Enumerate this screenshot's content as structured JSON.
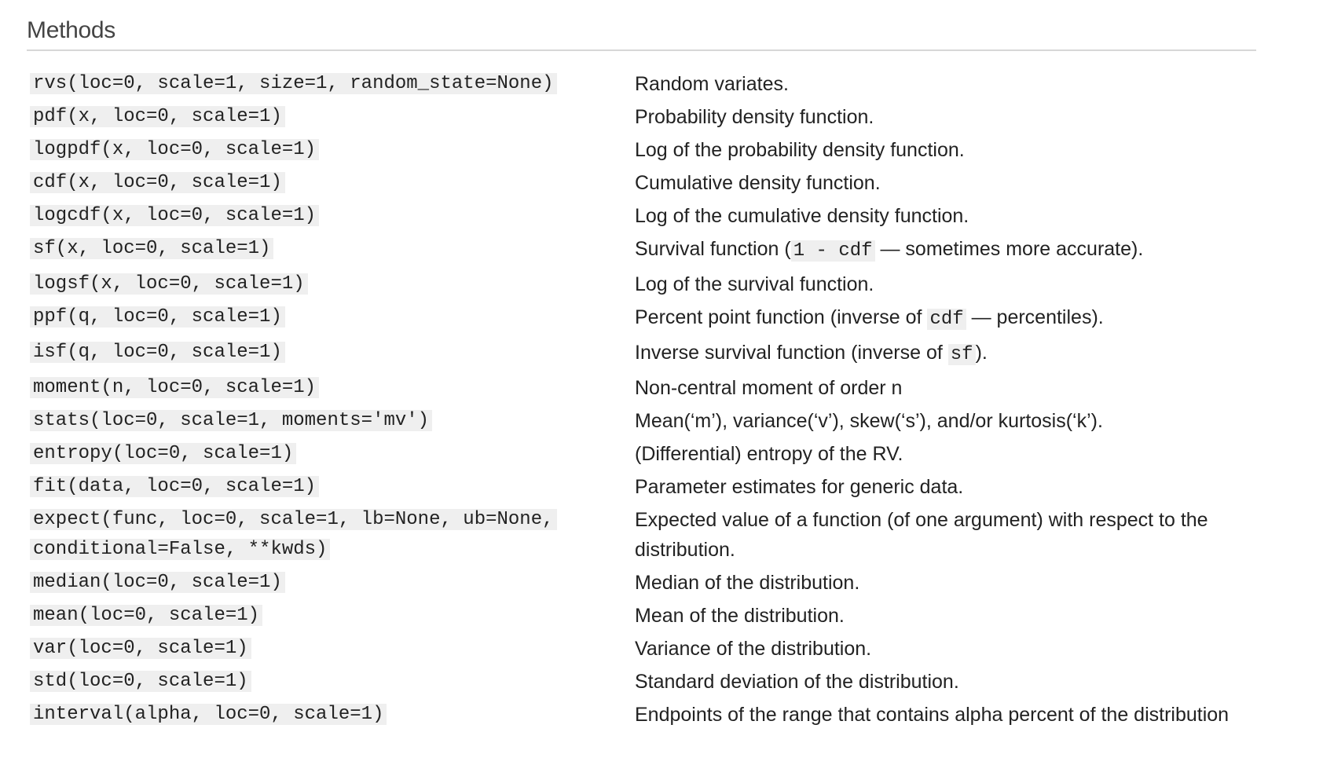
{
  "section": {
    "title": "Methods"
  },
  "methods": [
    {
      "signature": "rvs(loc=0, scale=1, size=1, random_state=None)",
      "desc": [
        "Random variates."
      ]
    },
    {
      "signature": "pdf(x, loc=0, scale=1)",
      "desc": [
        "Probability density function."
      ]
    },
    {
      "signature": "logpdf(x, loc=0, scale=1)",
      "desc": [
        "Log of the probability density function."
      ]
    },
    {
      "signature": "cdf(x, loc=0, scale=1)",
      "desc": [
        "Cumulative density function."
      ]
    },
    {
      "signature": "logcdf(x, loc=0, scale=1)",
      "desc": [
        "Log of the cumulative density function."
      ]
    },
    {
      "signature": "sf(x, loc=0, scale=1)",
      "desc": [
        "Survival function (",
        {
          "code": "1 - cdf"
        },
        " — sometimes more accurate)."
      ]
    },
    {
      "signature": "logsf(x, loc=0, scale=1)",
      "desc": [
        "Log of the survival function."
      ]
    },
    {
      "signature": "ppf(q, loc=0, scale=1)",
      "desc": [
        "Percent point function (inverse of ",
        {
          "code": "cdf"
        },
        " — percentiles)."
      ]
    },
    {
      "signature": "isf(q, loc=0, scale=1)",
      "desc": [
        "Inverse survival function (inverse of ",
        {
          "code": "sf"
        },
        ")."
      ]
    },
    {
      "signature": "moment(n, loc=0, scale=1)",
      "desc": [
        "Non-central moment of order n"
      ]
    },
    {
      "signature": "stats(loc=0, scale=1, moments='mv')",
      "desc": [
        "Mean(‘m’), variance(‘v’), skew(‘s’), and/or kurtosis(‘k’)."
      ]
    },
    {
      "signature": "entropy(loc=0, scale=1)",
      "desc": [
        "(Differential) entropy of the RV."
      ]
    },
    {
      "signature": "fit(data, loc=0, scale=1)",
      "desc": [
        "Parameter estimates for generic data."
      ]
    },
    {
      "signature": "expect(func, loc=0, scale=1, lb=None, ub=None, conditional=False, **kwds)",
      "desc": [
        "Expected value of a function (of one argument) with respect to the distribution."
      ]
    },
    {
      "signature": "median(loc=0, scale=1)",
      "desc": [
        "Median of the distribution."
      ]
    },
    {
      "signature": "mean(loc=0, scale=1)",
      "desc": [
        "Mean of the distribution."
      ]
    },
    {
      "signature": "var(loc=0, scale=1)",
      "desc": [
        "Variance of the distribution."
      ]
    },
    {
      "signature": "std(loc=0, scale=1)",
      "desc": [
        "Standard deviation of the distribution."
      ]
    },
    {
      "signature": "interval(alpha, loc=0, scale=1)",
      "desc": [
        "Endpoints of the range that contains alpha percent of the distribution"
      ]
    }
  ]
}
